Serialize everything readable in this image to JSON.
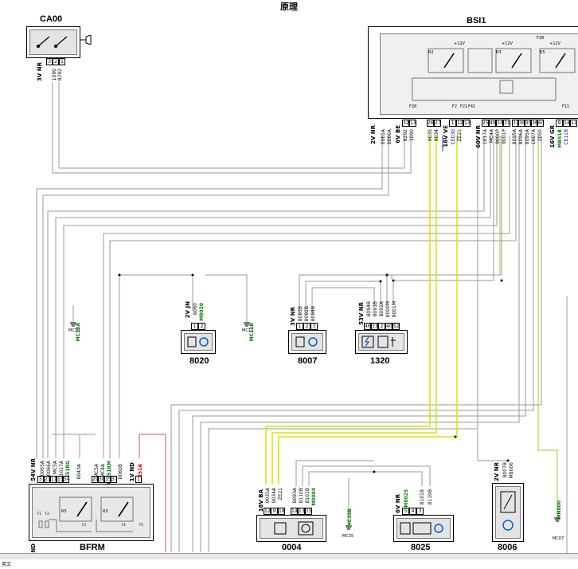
{
  "page_title": "原理",
  "bottom_bar": {
    "label": "英文"
  },
  "modules": {
    "ca00": {
      "title": "CA00",
      "connector": "3V NR",
      "pins": [
        "3",
        "2",
        "1"
      ],
      "wires": [
        "1090",
        "8292"
      ]
    },
    "bsi1": {
      "title": "BSI1",
      "fuse_label": "F28",
      "inner_fuse_label": "F28",
      "relays": [
        "R2",
        "R3",
        "R5"
      ],
      "voltages": [
        "+12V",
        "+12V",
        "+12V"
      ],
      "fuses_small": [
        "F2",
        "F21",
        "F41",
        "F11"
      ],
      "connector_groups": [
        {
          "label": "2V NR",
          "pins": [],
          "wires": [
            "0065A",
            "0066A"
          ]
        },
        {
          "label": "6V BE",
          "pins": [
            "32",
            "13"
          ],
          "wires": [
            "8292",
            "1090"
          ]
        },
        {
          "label": "",
          "pins": [
            "26",
            "27"
          ],
          "wires": [
            "9035",
            "9034"
          ]
        },
        {
          "label": "16V VE",
          "pins": [
            "1",
            "12",
            "13"
          ],
          "wires": [
            "CE030",
            "ZE21"
          ],
          "highlight": "CE030"
        },
        {
          "label": "60V NR",
          "pins": [
            "25",
            "49",
            "33",
            "31"
          ],
          "wires": [
            "1017A",
            "MC4A",
            "9000P",
            "9001P"
          ]
        },
        {
          "label": "",
          "pins": [
            "37",
            "38",
            "35",
            "36",
            "60"
          ],
          "wires": [
            "8095A",
            "8096A",
            "8095A",
            "1007A",
            "2050"
          ]
        },
        {
          "label": "16V GR",
          "pins": [
            "9",
            "14",
            "11"
          ],
          "wires": [
            "MB51B",
            "CE11B"
          ],
          "highlight": "MB51B"
        }
      ]
    },
    "m8020": {
      "title": "8020",
      "connector": "2V JN",
      "pins": [
        "1",
        "2"
      ],
      "wires": [
        "8060",
        "M8020"
      ],
      "highlight": "M8020"
    },
    "m8007": {
      "title": "8007",
      "connector": "3V NR",
      "pins": [
        "1",
        "2",
        "3"
      ],
      "wires": [
        "8093B",
        "8092B",
        "8094B"
      ]
    },
    "m1320": {
      "title": "1320",
      "connector": "53V NR",
      "pins": [
        "46",
        "33",
        "2",
        "40",
        "52"
      ],
      "wires": [
        "8094B",
        "8093B",
        "8092A",
        "9000M",
        "9001M"
      ]
    },
    "bfrm": {
      "title": "BFRM",
      "connector": "54V NR",
      "connector_2": "1V ND",
      "relays": [
        "R5",
        "R3"
      ],
      "fuses": [
        "F1",
        "F2",
        "F3",
        "F4",
        "F5"
      ],
      "pins": [
        "5",
        "21",
        "11",
        "15",
        "54",
        "29",
        "38",
        "35",
        "37",
        "1"
      ],
      "wires": [
        "0065A",
        "0066A",
        "MC5A",
        "1017A",
        "MB51RG",
        "8043A",
        "MC5A",
        "MC4A",
        "MB51RM",
        "8060B",
        "BR51A"
      ],
      "highlight_green": [
        "MB51RG",
        "MB51RM"
      ],
      "highlight_red": "BR51A",
      "bottom_label": "ND"
    },
    "m0004": {
      "title": "0004",
      "connector": "18V BA",
      "pins": [
        "12",
        "9",
        "18",
        "14",
        "13",
        "15"
      ],
      "wires": [
        "9035A",
        "9034A",
        "ZE21",
        "8093A",
        "8110B",
        "8101B",
        "M0004"
      ],
      "highlight": "M0004"
    },
    "m8025": {
      "title": "8025",
      "connector": "6V NR",
      "pins": [
        "5",
        "4",
        "3"
      ],
      "wires": [
        "M8025",
        "8101B",
        "8110B"
      ],
      "highlight": "M8025"
    },
    "m8006": {
      "title": "8006",
      "connector": "2V NR",
      "pins": [
        "1",
        "2"
      ],
      "wires": [
        "8007B",
        "M8006"
      ]
    }
  },
  "grounds": [
    {
      "id": "mc10",
      "wire": "MC10A",
      "label": "MC10"
    },
    {
      "id": "mc11",
      "wire": "MC11B",
      "label": "MC11"
    },
    {
      "id": "mc35",
      "wire": "MC35B",
      "label": "MC35"
    },
    {
      "id": "mc07",
      "wire": "MN800",
      "label": "MC07"
    }
  ],
  "colors": {
    "wire_gray": "#9a9a9a",
    "wire_yellow": "#e0e000",
    "wire_green": "#9acd32",
    "wire_red": "#e05050",
    "wire_blue": "#2020ff",
    "text_green": "#008000",
    "text_red": "#d00000",
    "text_blue": "#0000c0"
  }
}
